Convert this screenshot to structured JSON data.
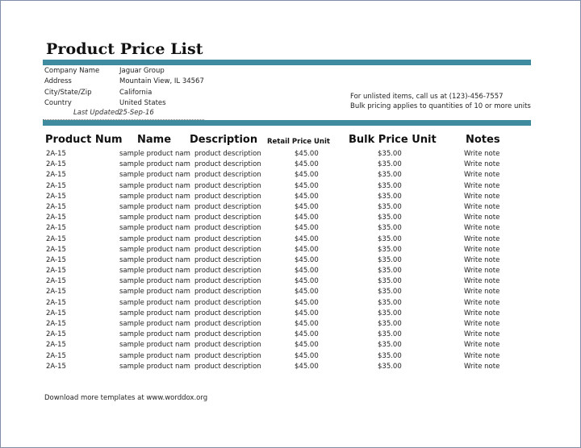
{
  "title": "Product Price List",
  "company": {
    "labels": [
      "Company Name",
      "Address",
      "City/State/Zip",
      "Country"
    ],
    "values": [
      "Jaguar Group",
      "Mountain View, IL 34567",
      "California",
      "United States"
    ],
    "last_updated_label": "Last Updated:",
    "last_updated_value": "25-Sep-16"
  },
  "notes": {
    "line1": "For unlisted items, call us at (123)-456-7557",
    "line2": "Bulk pricing applies to quantities of 10 or more units"
  },
  "columns": {
    "num": "Product Num",
    "name": "Name",
    "desc": "Description",
    "retail": "Retail Price Unit",
    "bulk": "Bulk Price Unit",
    "notes": "Notes"
  },
  "rows": [
    {
      "num": "2A-15",
      "name": "sample product name",
      "desc": "product description",
      "retail": "$45.00",
      "bulk": "$35.00",
      "note": "Write note"
    },
    {
      "num": "2A-15",
      "name": "sample product name",
      "desc": "product description",
      "retail": "$45.00",
      "bulk": "$35.00",
      "note": "Write note"
    },
    {
      "num": "2A-15",
      "name": "sample product name",
      "desc": "product description",
      "retail": "$45.00",
      "bulk": "$35.00",
      "note": "Write note"
    },
    {
      "num": "2A-15",
      "name": "sample product name",
      "desc": "product description",
      "retail": "$45.00",
      "bulk": "$35.00",
      "note": "Write note"
    },
    {
      "num": "2A-15",
      "name": "sample product name",
      "desc": "product description",
      "retail": "$45.00",
      "bulk": "$35.00",
      "note": "Write note"
    },
    {
      "num": "2A-15",
      "name": "sample product name",
      "desc": "product description",
      "retail": "$45.00",
      "bulk": "$35.00",
      "note": "Write note"
    },
    {
      "num": "2A-15",
      "name": "sample product name",
      "desc": "product description",
      "retail": "$45.00",
      "bulk": "$35.00",
      "note": "Write note"
    },
    {
      "num": "2A-15",
      "name": "sample product name",
      "desc": "product description",
      "retail": "$45.00",
      "bulk": "$35.00",
      "note": "Write note"
    },
    {
      "num": "2A-15",
      "name": "sample product name",
      "desc": "product description",
      "retail": "$45.00",
      "bulk": "$35.00",
      "note": "Write note"
    },
    {
      "num": "2A-15",
      "name": "sample product name",
      "desc": "product description",
      "retail": "$45.00",
      "bulk": "$35.00",
      "note": "Write note"
    },
    {
      "num": "2A-15",
      "name": "sample product name",
      "desc": "product description",
      "retail": "$45.00",
      "bulk": "$35.00",
      "note": "Write note"
    },
    {
      "num": "2A-15",
      "name": "sample product name",
      "desc": "product description",
      "retail": "$45.00",
      "bulk": "$35.00",
      "note": "Write note"
    },
    {
      "num": "2A-15",
      "name": "sample product name",
      "desc": "product description",
      "retail": "$45.00",
      "bulk": "$35.00",
      "note": "Write note"
    },
    {
      "num": "2A-15",
      "name": "sample product name",
      "desc": "product description",
      "retail": "$45.00",
      "bulk": "$35.00",
      "note": "Write note"
    },
    {
      "num": "2A-15",
      "name": "sample product name",
      "desc": "product description",
      "retail": "$45.00",
      "bulk": "$35.00",
      "note": "Write note"
    },
    {
      "num": "2A-15",
      "name": "sample product name",
      "desc": "product description",
      "retail": "$45.00",
      "bulk": "$35.00",
      "note": "Write note"
    },
    {
      "num": "2A-15",
      "name": "sample product name",
      "desc": "product description",
      "retail": "$45.00",
      "bulk": "$35.00",
      "note": "Write note"
    },
    {
      "num": "2A-15",
      "name": "sample product name",
      "desc": "product description",
      "retail": "$45.00",
      "bulk": "$35.00",
      "note": "Write note"
    },
    {
      "num": "2A-15",
      "name": "sample product name",
      "desc": "product description",
      "retail": "$45.00",
      "bulk": "$35.00",
      "note": "Write note"
    },
    {
      "num": "2A-15",
      "name": "sample product name",
      "desc": "product description",
      "retail": "$45.00",
      "bulk": "$35.00",
      "note": "Write note"
    },
    {
      "num": "2A-15",
      "name": "sample product name",
      "desc": "product description",
      "retail": "$45.00",
      "bulk": "$35.00",
      "note": "Write note"
    }
  ],
  "footer": "Download more templates at www.worddox.org",
  "colors": {
    "accent_bar": "#3e8ba0"
  }
}
